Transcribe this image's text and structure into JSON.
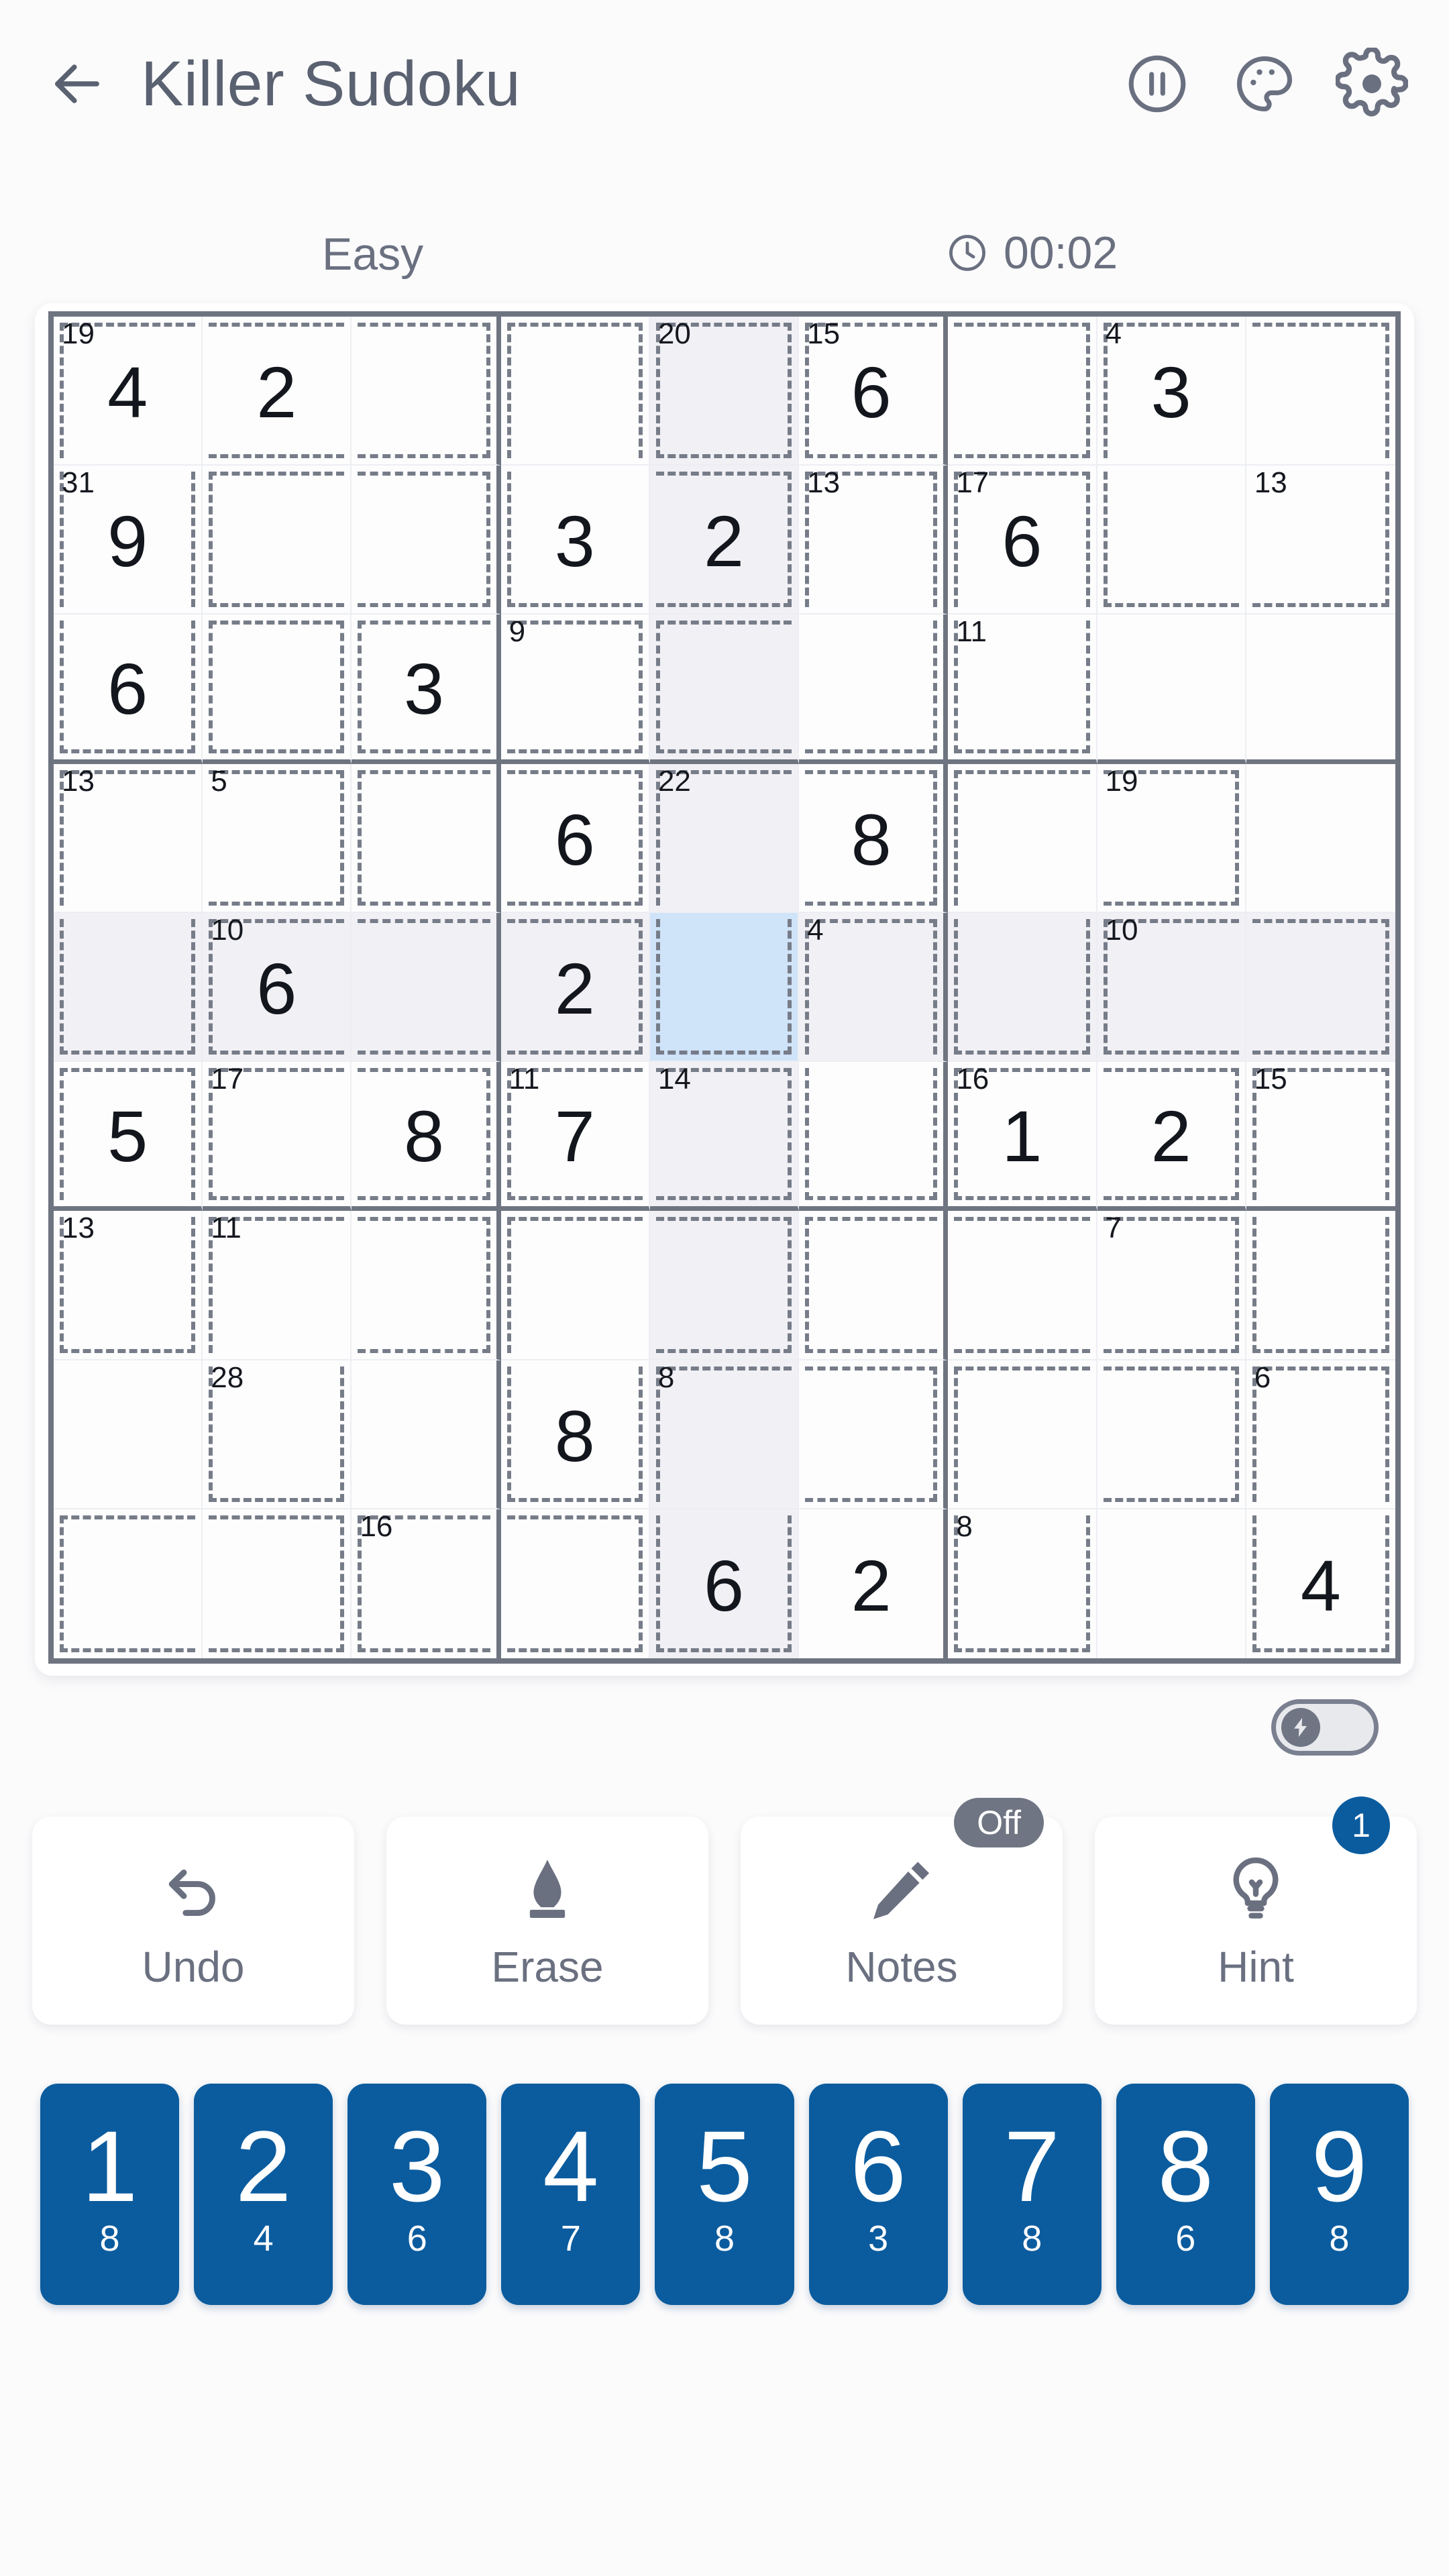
{
  "header": {
    "title": "Killer Sudoku",
    "back_icon": "back-arrow-icon",
    "pause_icon": "pause-icon",
    "theme_icon": "palette-icon",
    "settings_icon": "gear-icon"
  },
  "meta": {
    "difficulty": "Easy",
    "timer": "00:02",
    "clock_icon": "clock-icon"
  },
  "board": {
    "selected_cell": {
      "row": 5,
      "col": 5
    },
    "highlight_row": 5,
    "highlight_col": 5,
    "selected_color": "#cfe3f9",
    "highlight_color": "#f1f0f5",
    "cage_line_color": "#767c88",
    "grid_line_color": "#6e7480",
    "values": [
      [
        "4",
        "2",
        "",
        "",
        "",
        "6",
        "",
        "3",
        ""
      ],
      [
        "9",
        "",
        "",
        "3",
        "2",
        "",
        "6",
        "",
        ""
      ],
      [
        "6",
        "",
        "3",
        "",
        "",
        "",
        "",
        "",
        ""
      ],
      [
        "",
        "",
        "",
        "6",
        "",
        "8",
        "",
        "",
        ""
      ],
      [
        "",
        "6",
        "",
        "2",
        "",
        "",
        "",
        "",
        ""
      ],
      [
        "5",
        "",
        "8",
        "7",
        "",
        "",
        "1",
        "2",
        ""
      ],
      [
        "",
        "",
        "",
        "",
        "",
        "",
        "",
        "",
        ""
      ],
      [
        "",
        "",
        "",
        "8",
        "",
        "",
        "",
        "",
        ""
      ],
      [
        "",
        "",
        "",
        "",
        "6",
        "2",
        "",
        "",
        "4"
      ]
    ],
    "cage_sums": [
      {
        "row": 1,
        "col": 1,
        "sum": "19"
      },
      {
        "row": 1,
        "col": 5,
        "sum": "20"
      },
      {
        "row": 1,
        "col": 6,
        "sum": "15"
      },
      {
        "row": 1,
        "col": 8,
        "sum": "4"
      },
      {
        "row": 2,
        "col": 1,
        "sum": "31"
      },
      {
        "row": 2,
        "col": 6,
        "sum": "13"
      },
      {
        "row": 2,
        "col": 7,
        "sum": "17"
      },
      {
        "row": 2,
        "col": 9,
        "sum": "13"
      },
      {
        "row": 3,
        "col": 4,
        "sum": "9"
      },
      {
        "row": 3,
        "col": 7,
        "sum": "11"
      },
      {
        "row": 4,
        "col": 1,
        "sum": "13"
      },
      {
        "row": 4,
        "col": 2,
        "sum": "5"
      },
      {
        "row": 4,
        "col": 5,
        "sum": "22"
      },
      {
        "row": 4,
        "col": 8,
        "sum": "19"
      },
      {
        "row": 5,
        "col": 2,
        "sum": "10"
      },
      {
        "row": 5,
        "col": 6,
        "sum": "4"
      },
      {
        "row": 5,
        "col": 8,
        "sum": "10"
      },
      {
        "row": 6,
        "col": 2,
        "sum": "17"
      },
      {
        "row": 6,
        "col": 4,
        "sum": "11"
      },
      {
        "row": 6,
        "col": 5,
        "sum": "14"
      },
      {
        "row": 6,
        "col": 7,
        "sum": "16"
      },
      {
        "row": 6,
        "col": 9,
        "sum": "15"
      },
      {
        "row": 7,
        "col": 1,
        "sum": "13"
      },
      {
        "row": 7,
        "col": 2,
        "sum": "11"
      },
      {
        "row": 7,
        "col": 8,
        "sum": "7"
      },
      {
        "row": 8,
        "col": 2,
        "sum": "28"
      },
      {
        "row": 8,
        "col": 5,
        "sum": "8"
      },
      {
        "row": 8,
        "col": 9,
        "sum": "6"
      },
      {
        "row": 9,
        "col": 3,
        "sum": "16"
      },
      {
        "row": 9,
        "col": 7,
        "sum": "8"
      }
    ],
    "cages": [
      [
        [
          1,
          1
        ],
        [
          1,
          2
        ],
        [
          1,
          3
        ],
        [
          2,
          1
        ],
        [
          3,
          1
        ]
      ],
      [
        [
          1,
          4
        ],
        [
          2,
          4
        ],
        [
          2,
          5
        ]
      ],
      [
        [
          1,
          5
        ]
      ],
      [
        [
          1,
          6
        ],
        [
          1,
          7
        ]
      ],
      [
        [
          1,
          8
        ],
        [
          1,
          9
        ],
        [
          2,
          8
        ],
        [
          2,
          9
        ]
      ],
      [
        [
          2,
          2
        ],
        [
          2,
          3
        ]
      ],
      [
        [
          2,
          6
        ],
        [
          3,
          5
        ],
        [
          3,
          6
        ]
      ],
      [
        [
          2,
          7
        ],
        [
          3,
          7
        ]
      ],
      [
        [
          3,
          2
        ],
        [
          3,
          3
        ]
      ],
      [
        [
          3,
          4
        ],
        [
          3,
          3
        ]
      ],
      [
        [
          4,
          1
        ],
        [
          4,
          2
        ],
        [
          5,
          1
        ]
      ],
      [
        [
          4,
          3
        ],
        [
          4,
          4
        ]
      ],
      [
        [
          4,
          5
        ],
        [
          4,
          6
        ],
        [
          5,
          5
        ]
      ],
      [
        [
          4,
          7
        ],
        [
          4,
          8
        ],
        [
          5,
          7
        ]
      ],
      [
        [
          5,
          2
        ],
        [
          5,
          3
        ],
        [
          5,
          4
        ]
      ],
      [
        [
          5,
          6
        ],
        [
          6,
          6
        ]
      ],
      [
        [
          5,
          8
        ],
        [
          5,
          9
        ]
      ],
      [
        [
          6,
          1
        ],
        [
          7,
          1
        ]
      ],
      [
        [
          6,
          2
        ],
        [
          6,
          3
        ]
      ],
      [
        [
          6,
          4
        ],
        [
          6,
          5
        ]
      ],
      [
        [
          6,
          7
        ],
        [
          6,
          8
        ]
      ],
      [
        [
          6,
          9
        ],
        [
          7,
          9
        ]
      ],
      [
        [
          7,
          2
        ],
        [
          7,
          3
        ],
        [
          8,
          2
        ]
      ],
      [
        [
          7,
          4
        ],
        [
          7,
          5
        ],
        [
          8,
          4
        ]
      ],
      [
        [
          7,
          6
        ],
        [
          7,
          7
        ],
        [
          7,
          8
        ]
      ],
      [
        [
          8,
          5
        ],
        [
          8,
          6
        ],
        [
          9,
          5
        ]
      ],
      [
        [
          8,
          7
        ],
        [
          8,
          8
        ],
        [
          9,
          7
        ]
      ],
      [
        [
          8,
          9
        ],
        [
          9,
          9
        ]
      ],
      [
        [
          9,
          1
        ],
        [
          9,
          2
        ]
      ],
      [
        [
          9,
          3
        ],
        [
          9,
          4
        ]
      ]
    ]
  },
  "auto_toggle": {
    "state": "off",
    "icon": "lightning-bolt-icon"
  },
  "actions": [
    {
      "label": "Undo",
      "icon": "undo-arrow-icon",
      "badge": null
    },
    {
      "label": "Erase",
      "icon": "eraser-icon",
      "badge": null
    },
    {
      "label": "Notes",
      "icon": "pencil-icon",
      "badge": "Off"
    },
    {
      "label": "Hint",
      "icon": "lightbulb-icon",
      "badge": "1"
    }
  ],
  "numpad": [
    {
      "digit": "1",
      "count": "8"
    },
    {
      "digit": "2",
      "count": "4"
    },
    {
      "digit": "3",
      "count": "6"
    },
    {
      "digit": "4",
      "count": "7"
    },
    {
      "digit": "5",
      "count": "8"
    },
    {
      "digit": "6",
      "count": "3"
    },
    {
      "digit": "7",
      "count": "8"
    },
    {
      "digit": "8",
      "count": "6"
    },
    {
      "digit": "9",
      "count": "8"
    }
  ],
  "colors": {
    "accent_blue": "#0b5c9e",
    "text_gray": "#6a7080",
    "grid_border": "#6e7480"
  }
}
